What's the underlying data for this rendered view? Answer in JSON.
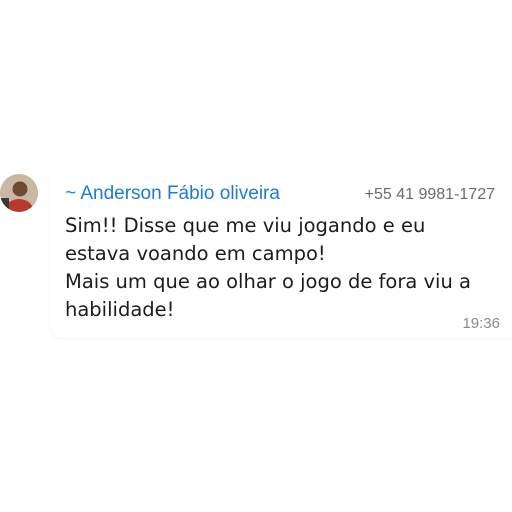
{
  "message": {
    "sender_name": "~ Anderson Fábio oliveira",
    "sender_phone": "+55 41 9981-1727",
    "text": "Sim!! Disse que me viu jogando e eu\nestava voando em campo!\nMais um que ao olhar o jogo de fora viu a\nhabilidade!",
    "time": "19:36"
  },
  "colors": {
    "sender_name": "#1f7bd0",
    "phone": "#6b6b6b",
    "text": "#1c1c1c",
    "time": "#8a8a8a"
  },
  "icons": {
    "avatar": "avatar-photo"
  }
}
